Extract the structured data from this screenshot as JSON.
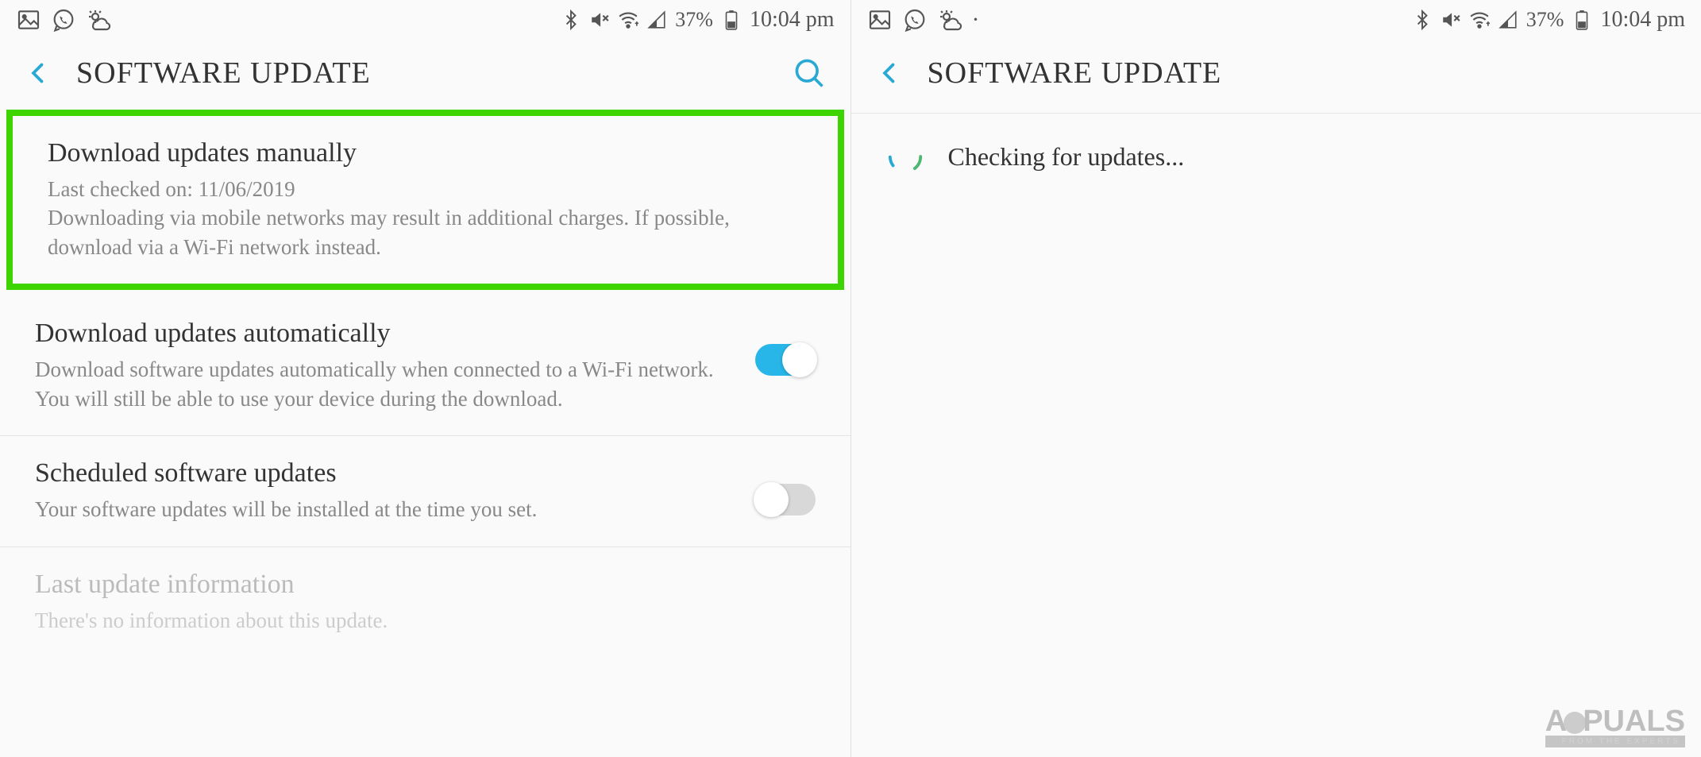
{
  "status_bar": {
    "battery_percent": "37%",
    "time": "10:04 pm"
  },
  "left": {
    "header": {
      "title": "SOFTWARE UPDATE"
    },
    "items": {
      "manual": {
        "title": "Download updates manually",
        "last_checked": "Last checked on: 11/06/2019",
        "desc": "Downloading via mobile networks may result in additional charges. If possible, download via a Wi-Fi network instead."
      },
      "auto": {
        "title": "Download updates automatically",
        "desc": "Download software updates automatically when connected to a Wi-Fi network. You will still be able to use your device during the download.",
        "toggle": true
      },
      "scheduled": {
        "title": "Scheduled software updates",
        "desc": "Your software updates will be installed at the time you set.",
        "toggle": false
      },
      "last_update": {
        "title": "Last update information",
        "desc": "There's no information about this update."
      }
    }
  },
  "right": {
    "header": {
      "title": "SOFTWARE UPDATE"
    },
    "checking_text": "Checking for updates..."
  },
  "watermark": {
    "text": "A PUALS",
    "sub": "FROM THE EXPERTS"
  }
}
